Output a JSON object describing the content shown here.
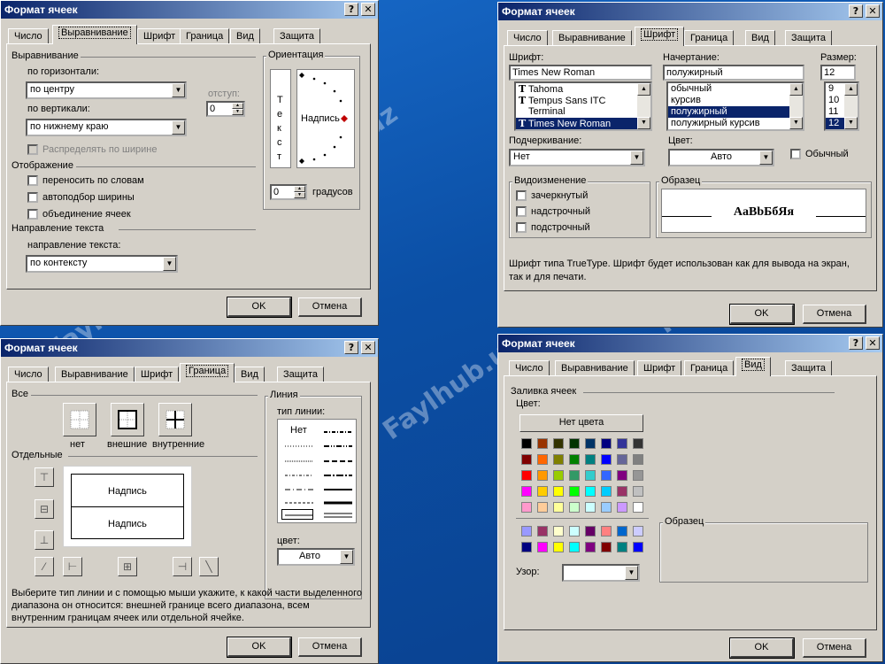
{
  "watermark": "Faylhub.uz",
  "dialogs": {
    "d1": {
      "title": "Формат ячеек",
      "tabs": [
        "Число",
        "Выравнивание",
        "Шрифт",
        "Граница",
        "Вид",
        "Защита"
      ],
      "alignment_group": "Выравнивание",
      "horizontal_label": "по горизонтали:",
      "horizontal_value": "по центру",
      "vertical_label": "по вертикали:",
      "vertical_value": "по нижнему краю",
      "indent_label": "отступ:",
      "indent_value": "0",
      "distribute_label": "Распределять по ширине",
      "display_group": "Отображение",
      "checks": [
        "переносить по словам",
        "автоподбор ширины",
        "объединение ячеек"
      ],
      "direction_group": "Направление текста",
      "direction_label": "направление текста:",
      "direction_value": "по контексту",
      "orientation_group": "Ориентация",
      "vertical_text": "Текст",
      "orient_label": "Надпись",
      "degrees_value": "0",
      "degrees_label": "градусов",
      "ok": "OK",
      "cancel": "Отмена"
    },
    "d2": {
      "title": "Формат ячеек",
      "tabs": [
        "Число",
        "Выравнивание",
        "Шрифт",
        "Граница",
        "Вид",
        "Защита"
      ],
      "font_label": "Шрифт:",
      "font_value": "Times New Roman",
      "fonts": [
        "Tahoma",
        "Tempus Sans ITC",
        "Terminal",
        "Times New Roman"
      ],
      "style_label": "Начертание:",
      "style_value": "полужирный",
      "styles": [
        "обычный",
        "курсив",
        "полужирный",
        "полужирный курсив"
      ],
      "size_label": "Размер:",
      "size_value": "12",
      "sizes": [
        "9",
        "10",
        "11",
        "12"
      ],
      "underline_label": "Подчеркивание:",
      "underline_value": "Нет",
      "color_label": "Цвет:",
      "color_value": "Авто",
      "normal_label": "Обычный",
      "effects_group": "Видоизменение",
      "effects": [
        "зачеркнутый",
        "надстрочный",
        "подстрочный"
      ],
      "sample_group": "Образец",
      "sample_text": "AaBbБбЯя",
      "info": "Шрифт типа TrueType. Шрифт будет использован как для вывода на экран, так и для печати.",
      "ok": "OK",
      "cancel": "Отмена"
    },
    "d3": {
      "title": "Формат ячеек",
      "tabs": [
        "Число",
        "Выравнивание",
        "Шрифт",
        "Граница",
        "Вид",
        "Защита"
      ],
      "all_group": "Все",
      "presets": [
        "нет",
        "внешние",
        "внутренние"
      ],
      "separate_group": "Отдельные",
      "preview_text": "Надпись",
      "line_group": "Линия",
      "line_type_label": "тип линии:",
      "line_none": "Нет",
      "color_label": "цвет:",
      "color_value": "Авто",
      "info": "Выберите тип линии и с помощью мыши укажите, к какой части выделенного диапазона он относится: внешней границе всего диапазона, всем внутренним границам ячеек или отдельной ячейке.",
      "ok": "OK",
      "cancel": "Отмена"
    },
    "d4": {
      "title": "Формат ячеек",
      "tabs": [
        "Число",
        "Выравнивание",
        "Шрифт",
        "Граница",
        "Вид",
        "Защита"
      ],
      "fill_group": "Заливка ячеек",
      "color_label": "Цвет:",
      "no_color": "Нет цвета",
      "sample_group": "Образец",
      "pattern_label": "Узор:",
      "ok": "OK",
      "cancel": "Отмена"
    }
  },
  "palette_main": [
    [
      "#000000",
      "#993300",
      "#333300",
      "#003300",
      "#003366",
      "#000080",
      "#333399",
      "#333333"
    ],
    [
      "#800000",
      "#FF6600",
      "#808000",
      "#008000",
      "#008080",
      "#0000FF",
      "#666699",
      "#808080"
    ],
    [
      "#FF0000",
      "#FF9900",
      "#99CC00",
      "#339966",
      "#33CCCC",
      "#3366FF",
      "#800080",
      "#969696"
    ],
    [
      "#FF00FF",
      "#FFCC00",
      "#FFFF00",
      "#00FF00",
      "#00FFFF",
      "#00CCFF",
      "#993366",
      "#C0C0C0"
    ],
    [
      "#FF99CC",
      "#FFCC99",
      "#FFFF99",
      "#CCFFCC",
      "#CCFFFF",
      "#99CCFF",
      "#CC99FF",
      "#FFFFFF"
    ]
  ],
  "palette_chart": [
    [
      "#9999FF",
      "#993366",
      "#FFFFCC",
      "#CCFFFF",
      "#660066",
      "#FF8080",
      "#0066CC",
      "#CCCCFF"
    ],
    [
      "#000080",
      "#FF00FF",
      "#FFFF00",
      "#00FFFF",
      "#800080",
      "#800000",
      "#008080",
      "#0000FF"
    ]
  ]
}
